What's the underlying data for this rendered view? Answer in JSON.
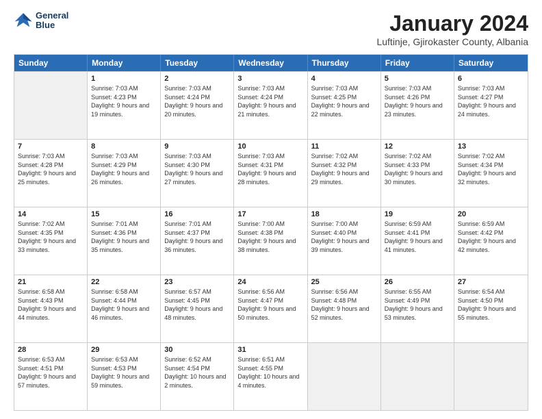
{
  "header": {
    "logo_line1": "General",
    "logo_line2": "Blue",
    "main_title": "January 2024",
    "subtitle": "Luftinje, Gjirokaster County, Albania"
  },
  "days": [
    "Sunday",
    "Monday",
    "Tuesday",
    "Wednesday",
    "Thursday",
    "Friday",
    "Saturday"
  ],
  "rows": [
    [
      {
        "day": "",
        "sunrise": "",
        "sunset": "",
        "daylight": "",
        "empty": true
      },
      {
        "day": "1",
        "sunrise": "Sunrise: 7:03 AM",
        "sunset": "Sunset: 4:23 PM",
        "daylight": "Daylight: 9 hours and 19 minutes."
      },
      {
        "day": "2",
        "sunrise": "Sunrise: 7:03 AM",
        "sunset": "Sunset: 4:24 PM",
        "daylight": "Daylight: 9 hours and 20 minutes."
      },
      {
        "day": "3",
        "sunrise": "Sunrise: 7:03 AM",
        "sunset": "Sunset: 4:24 PM",
        "daylight": "Daylight: 9 hours and 21 minutes."
      },
      {
        "day": "4",
        "sunrise": "Sunrise: 7:03 AM",
        "sunset": "Sunset: 4:25 PM",
        "daylight": "Daylight: 9 hours and 22 minutes."
      },
      {
        "day": "5",
        "sunrise": "Sunrise: 7:03 AM",
        "sunset": "Sunset: 4:26 PM",
        "daylight": "Daylight: 9 hours and 23 minutes."
      },
      {
        "day": "6",
        "sunrise": "Sunrise: 7:03 AM",
        "sunset": "Sunset: 4:27 PM",
        "daylight": "Daylight: 9 hours and 24 minutes."
      }
    ],
    [
      {
        "day": "7",
        "sunrise": "Sunrise: 7:03 AM",
        "sunset": "Sunset: 4:28 PM",
        "daylight": "Daylight: 9 hours and 25 minutes."
      },
      {
        "day": "8",
        "sunrise": "Sunrise: 7:03 AM",
        "sunset": "Sunset: 4:29 PM",
        "daylight": "Daylight: 9 hours and 26 minutes."
      },
      {
        "day": "9",
        "sunrise": "Sunrise: 7:03 AM",
        "sunset": "Sunset: 4:30 PM",
        "daylight": "Daylight: 9 hours and 27 minutes."
      },
      {
        "day": "10",
        "sunrise": "Sunrise: 7:03 AM",
        "sunset": "Sunset: 4:31 PM",
        "daylight": "Daylight: 9 hours and 28 minutes."
      },
      {
        "day": "11",
        "sunrise": "Sunrise: 7:02 AM",
        "sunset": "Sunset: 4:32 PM",
        "daylight": "Daylight: 9 hours and 29 minutes."
      },
      {
        "day": "12",
        "sunrise": "Sunrise: 7:02 AM",
        "sunset": "Sunset: 4:33 PM",
        "daylight": "Daylight: 9 hours and 30 minutes."
      },
      {
        "day": "13",
        "sunrise": "Sunrise: 7:02 AM",
        "sunset": "Sunset: 4:34 PM",
        "daylight": "Daylight: 9 hours and 32 minutes."
      }
    ],
    [
      {
        "day": "14",
        "sunrise": "Sunrise: 7:02 AM",
        "sunset": "Sunset: 4:35 PM",
        "daylight": "Daylight: 9 hours and 33 minutes."
      },
      {
        "day": "15",
        "sunrise": "Sunrise: 7:01 AM",
        "sunset": "Sunset: 4:36 PM",
        "daylight": "Daylight: 9 hours and 35 minutes."
      },
      {
        "day": "16",
        "sunrise": "Sunrise: 7:01 AM",
        "sunset": "Sunset: 4:37 PM",
        "daylight": "Daylight: 9 hours and 36 minutes."
      },
      {
        "day": "17",
        "sunrise": "Sunrise: 7:00 AM",
        "sunset": "Sunset: 4:38 PM",
        "daylight": "Daylight: 9 hours and 38 minutes."
      },
      {
        "day": "18",
        "sunrise": "Sunrise: 7:00 AM",
        "sunset": "Sunset: 4:40 PM",
        "daylight": "Daylight: 9 hours and 39 minutes."
      },
      {
        "day": "19",
        "sunrise": "Sunrise: 6:59 AM",
        "sunset": "Sunset: 4:41 PM",
        "daylight": "Daylight: 9 hours and 41 minutes."
      },
      {
        "day": "20",
        "sunrise": "Sunrise: 6:59 AM",
        "sunset": "Sunset: 4:42 PM",
        "daylight": "Daylight: 9 hours and 42 minutes."
      }
    ],
    [
      {
        "day": "21",
        "sunrise": "Sunrise: 6:58 AM",
        "sunset": "Sunset: 4:43 PM",
        "daylight": "Daylight: 9 hours and 44 minutes."
      },
      {
        "day": "22",
        "sunrise": "Sunrise: 6:58 AM",
        "sunset": "Sunset: 4:44 PM",
        "daylight": "Daylight: 9 hours and 46 minutes."
      },
      {
        "day": "23",
        "sunrise": "Sunrise: 6:57 AM",
        "sunset": "Sunset: 4:45 PM",
        "daylight": "Daylight: 9 hours and 48 minutes."
      },
      {
        "day": "24",
        "sunrise": "Sunrise: 6:56 AM",
        "sunset": "Sunset: 4:47 PM",
        "daylight": "Daylight: 9 hours and 50 minutes."
      },
      {
        "day": "25",
        "sunrise": "Sunrise: 6:56 AM",
        "sunset": "Sunset: 4:48 PM",
        "daylight": "Daylight: 9 hours and 52 minutes."
      },
      {
        "day": "26",
        "sunrise": "Sunrise: 6:55 AM",
        "sunset": "Sunset: 4:49 PM",
        "daylight": "Daylight: 9 hours and 53 minutes."
      },
      {
        "day": "27",
        "sunrise": "Sunrise: 6:54 AM",
        "sunset": "Sunset: 4:50 PM",
        "daylight": "Daylight: 9 hours and 55 minutes."
      }
    ],
    [
      {
        "day": "28",
        "sunrise": "Sunrise: 6:53 AM",
        "sunset": "Sunset: 4:51 PM",
        "daylight": "Daylight: 9 hours and 57 minutes."
      },
      {
        "day": "29",
        "sunrise": "Sunrise: 6:53 AM",
        "sunset": "Sunset: 4:53 PM",
        "daylight": "Daylight: 9 hours and 59 minutes."
      },
      {
        "day": "30",
        "sunrise": "Sunrise: 6:52 AM",
        "sunset": "Sunset: 4:54 PM",
        "daylight": "Daylight: 10 hours and 2 minutes."
      },
      {
        "day": "31",
        "sunrise": "Sunrise: 6:51 AM",
        "sunset": "Sunset: 4:55 PM",
        "daylight": "Daylight: 10 hours and 4 minutes."
      },
      {
        "day": "",
        "sunrise": "",
        "sunset": "",
        "daylight": "",
        "empty": true
      },
      {
        "day": "",
        "sunrise": "",
        "sunset": "",
        "daylight": "",
        "empty": true
      },
      {
        "day": "",
        "sunrise": "",
        "sunset": "",
        "daylight": "",
        "empty": true
      }
    ]
  ]
}
